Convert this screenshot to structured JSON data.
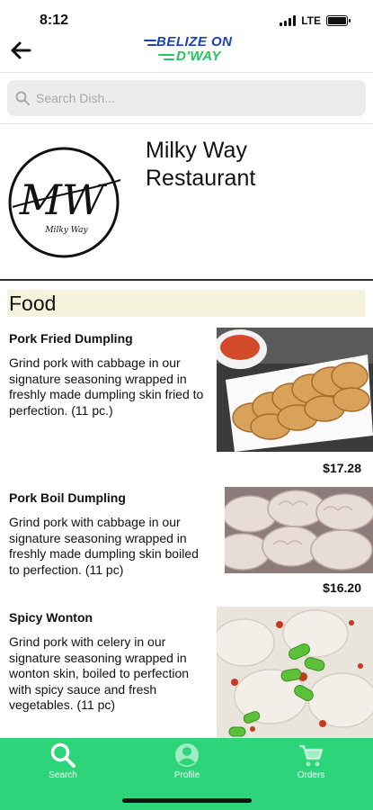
{
  "status": {
    "time": "8:12",
    "network": "LTE"
  },
  "brand": {
    "line1": "BELIZE ON",
    "line2": "D'WAY"
  },
  "search": {
    "placeholder": "Search Dish..."
  },
  "restaurant": {
    "name": "Milky Way Restaurant",
    "logo_text": "MW",
    "logo_sub": "Milky Way"
  },
  "section": {
    "title": "Food"
  },
  "items": [
    {
      "name": "Pork Fried Dumpling",
      "description": "Grind pork with cabbage in our signature seasoning wrapped in freshly made dumpling skin fried to perfection. (11 pc.)",
      "price": "$17.28"
    },
    {
      "name": "Pork Boil Dumpling",
      "description": "Grind pork with cabbage in our signature seasoning wrapped in freshly made dumpling skin boiled to perfection. (11 pc)",
      "price": "$16.20"
    },
    {
      "name": "Spicy Wonton",
      "description": "Grind pork with celery in our signature seasoning wrapped in wonton skin, boiled to perfection with spicy sauce and fresh vegetables. (11 pc)"
    }
  ],
  "nav": [
    {
      "label": "Search",
      "icon": "search-icon"
    },
    {
      "label": "Profile",
      "icon": "profile-icon"
    },
    {
      "label": "Orders",
      "icon": "cart-icon"
    }
  ],
  "colors": {
    "accent": "#2ed47a",
    "brand_blue": "#1a3fbf",
    "brand_green": "#22c55e",
    "section_bg": "#f6f3dc"
  }
}
